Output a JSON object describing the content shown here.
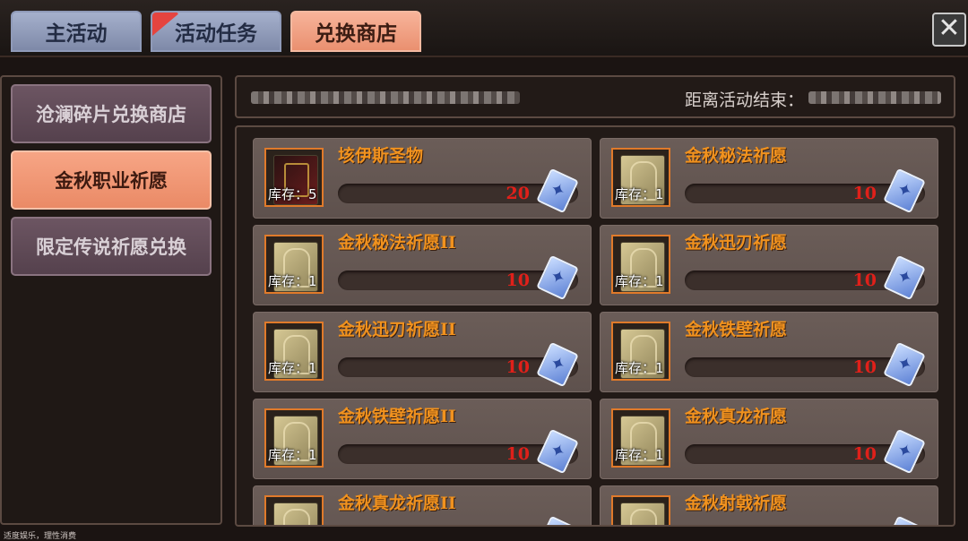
{
  "tabs": [
    {
      "label": "主活动",
      "active": false,
      "ribbon": false
    },
    {
      "label": "活动任务",
      "active": false,
      "ribbon": true
    },
    {
      "label": "兑换商店",
      "active": true,
      "ribbon": false
    }
  ],
  "close_label": "✕",
  "sidebar": {
    "items": [
      {
        "label": "沧澜碎片兑换商店",
        "selected": false
      },
      {
        "label": "金秋职业祈愿",
        "selected": true
      },
      {
        "label": "限定传说祈愿兑换",
        "selected": false
      }
    ]
  },
  "header": {
    "timer_label": "距离活动结束："
  },
  "shop": {
    "stock_prefix": "库存：",
    "items": [
      {
        "name": "垓伊斯圣物",
        "stock": "5",
        "price": "20",
        "icon": "relic-icon"
      },
      {
        "name": "金秋秘法祈愿",
        "stock": "1",
        "price": "10",
        "icon": "card-icon"
      },
      {
        "name": "金秋秘法祈愿II",
        "stock": "1",
        "price": "10",
        "icon": "card-icon"
      },
      {
        "name": "金秋迅刃祈愿",
        "stock": "1",
        "price": "10",
        "icon": "card-icon"
      },
      {
        "name": "金秋迅刃祈愿II",
        "stock": "1",
        "price": "10",
        "icon": "card-icon"
      },
      {
        "name": "金秋铁壁祈愿",
        "stock": "1",
        "price": "10",
        "icon": "card-icon"
      },
      {
        "name": "金秋铁壁祈愿II",
        "stock": "1",
        "price": "10",
        "icon": "card-icon"
      },
      {
        "name": "金秋真龙祈愿",
        "stock": "1",
        "price": "10",
        "icon": "card-icon"
      },
      {
        "name": "金秋真龙祈愿II",
        "stock": "",
        "price": "",
        "icon": "card-icon"
      },
      {
        "name": "金秋射戟祈愿",
        "stock": "",
        "price": "",
        "icon": "card-icon"
      }
    ]
  },
  "currency_icon": "coupon-icon",
  "footer_text": "适度娱乐，理性消费",
  "colors": {
    "item_name": "#f1921e",
    "price": "#e0201a",
    "active_tab": "#ea9070",
    "inactive_tab": "#7e89a8"
  }
}
